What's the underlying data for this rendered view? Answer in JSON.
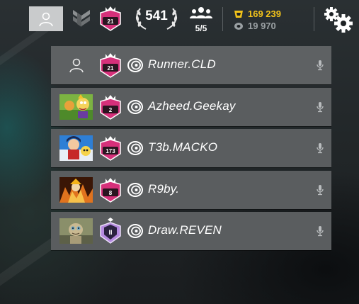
{
  "topbar": {
    "level": "541",
    "rank_number": "21",
    "squad_count": "5/5",
    "renown": "169 239",
    "credits": "19 970"
  },
  "colors": {
    "renown": "#f2c31b",
    "credits": "#9aa0a3",
    "champion_pink": "#d6307a",
    "row_bg": "#5a5d5f"
  },
  "squad": [
    {
      "name": "Runner.CLD",
      "rank": "21",
      "avatar": "empty-profile-icon",
      "badge": "champion"
    },
    {
      "name": "Azheed.Geekay",
      "rank": "2",
      "avatar": "cartoon-avatar",
      "badge": "champion"
    },
    {
      "name": "T3b.MACKO",
      "rank": "173",
      "avatar": "anime-avatar",
      "badge": "champion"
    },
    {
      "name": "R9by.",
      "rank": "8",
      "avatar": "fire-avatar",
      "badge": "champion"
    },
    {
      "name": "Draw.REVEN",
      "rank": "II",
      "avatar": "gollum-avatar",
      "badge": "diamond"
    }
  ]
}
